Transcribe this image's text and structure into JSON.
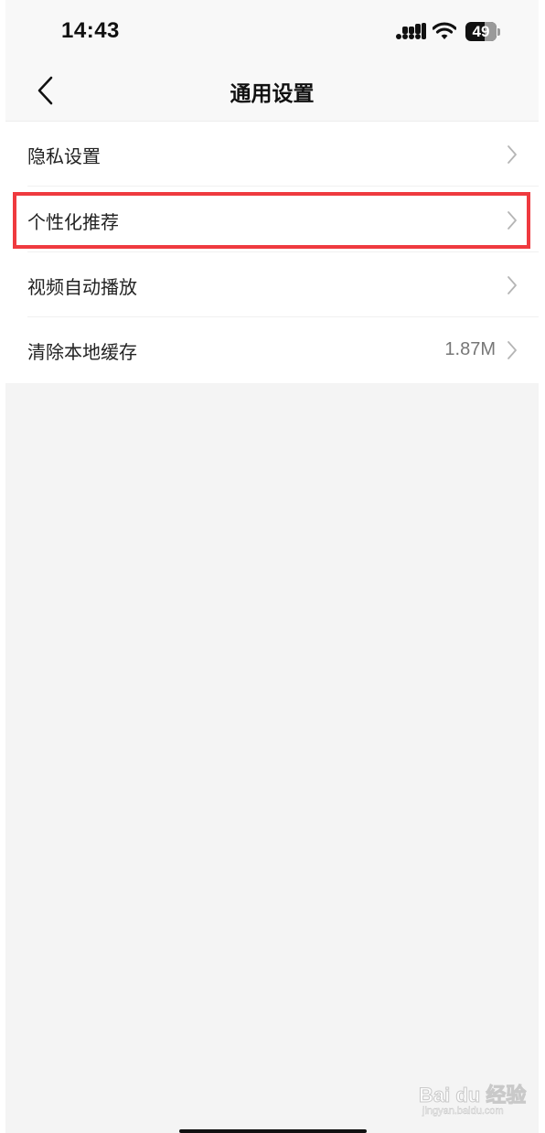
{
  "status_bar": {
    "time": "14:43",
    "battery": "49"
  },
  "header": {
    "title": "通用设置"
  },
  "settings": [
    {
      "label": "隐私设置",
      "value": ""
    },
    {
      "label": "个性化推荐",
      "value": ""
    },
    {
      "label": "视频自动播放",
      "value": ""
    },
    {
      "label": "清除本地缓存",
      "value": "1.87M"
    }
  ],
  "watermark": {
    "brand": "Bai du 经验",
    "url": "jingyan.baidu.com"
  },
  "colors": {
    "highlight": "#ef3a3f",
    "background": "#f4f4f4"
  }
}
